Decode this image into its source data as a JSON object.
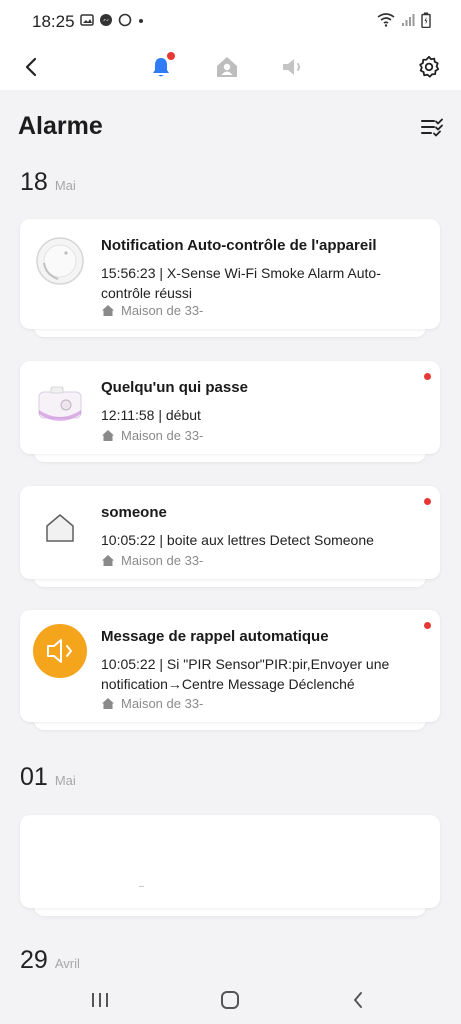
{
  "status_bar": {
    "time": "18:25"
  },
  "header": {
    "title": "Alarme"
  },
  "groups": [
    {
      "day": "18",
      "month": "Mai",
      "cards": [
        {
          "title": "Notification Auto-contrôle de l'appareil",
          "body": "15:56:23 | X-Sense Wi-Fi Smoke Alarm Auto-contrôle réussi",
          "location": "Maison de 33-"
        },
        {
          "title": "Quelqu'un qui passe",
          "body": "12:11:58 | début",
          "location": "Maison de 33-"
        },
        {
          "title": "someone",
          "body": "10:05:22 | boite aux lettres Detect Someone",
          "location": "Maison de 33-"
        },
        {
          "title": "Message de rappel automatique",
          "body": "10:05:22 | Si \"PIR Sensor\"PIR:pir,Envoyer une notification→Centre Message Déclenché",
          "location": "Maison de 33-"
        }
      ]
    },
    {
      "day": "01",
      "month": "Mai"
    },
    {
      "day": "29",
      "month": "Avril"
    }
  ],
  "colors": {
    "accent": "#2f7cf6",
    "unread": "#e53935",
    "reminder": "#f5a51c"
  }
}
